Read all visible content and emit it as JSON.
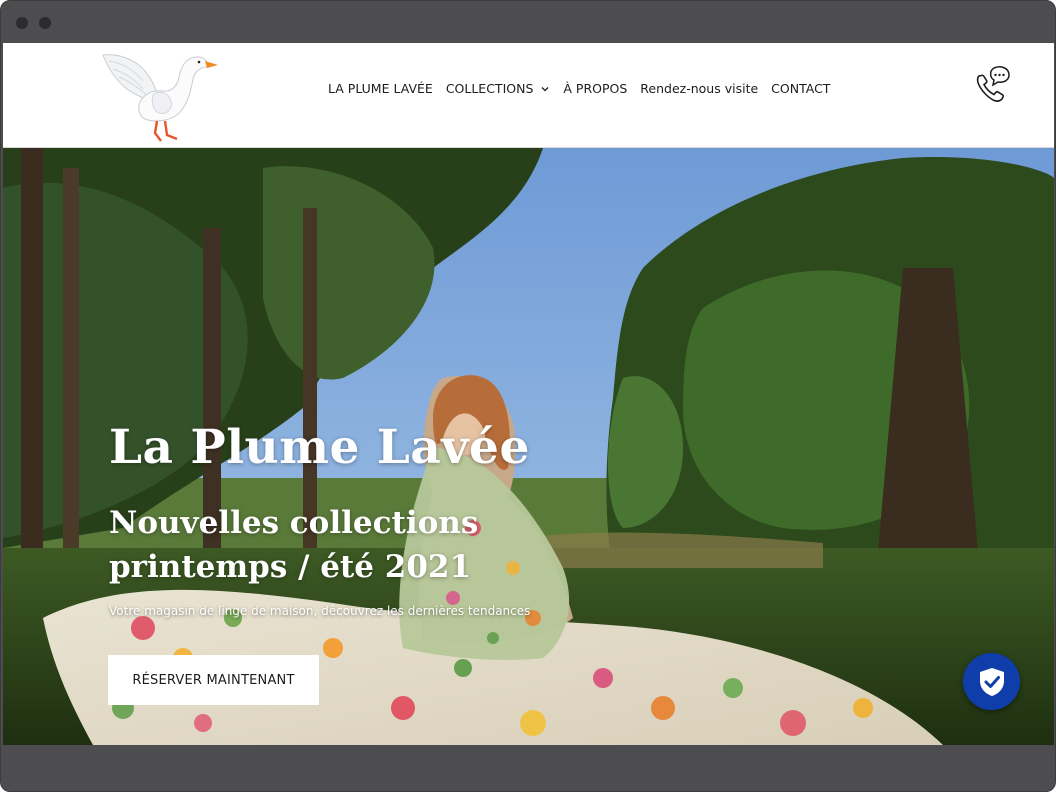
{
  "header": {
    "nav": [
      {
        "label": "LA PLUME LAVÉE"
      },
      {
        "label": "COLLECTIONS"
      },
      {
        "label": "À PROPOS"
      },
      {
        "label": "Rendez-nous visite"
      },
      {
        "label": "CONTACT"
      }
    ],
    "logo_icon": "white-goose-icon",
    "contact_icon": "phone-chat-icon"
  },
  "hero": {
    "title": "La Plume Lavée",
    "subtitle_line1": "Nouvelles collections",
    "subtitle_line2": "printemps / été 2021",
    "description": "Votre magasin de linge de maison, découvrez les dernières tendances",
    "cta_label": "RÉSERVER MAINTENANT"
  },
  "widgets": {
    "trust_badge_icon": "shield-check-icon",
    "trust_badge_color": "#0f3eab"
  }
}
